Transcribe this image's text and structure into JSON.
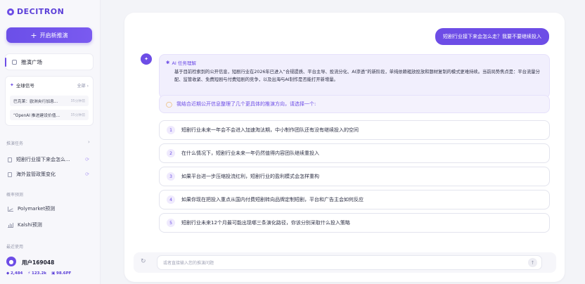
{
  "app": {
    "logo": "DECITRON"
  },
  "sidebar": {
    "new_button": "开启新推演",
    "square": "推演广场",
    "signals": {
      "title": "全球信号",
      "all": "全部",
      "items": [
        {
          "text": "巴克莱：欧洲央行加息...",
          "meta": "35分钟前"
        },
        {
          "text": "“OpenAI 推进建设价值...",
          "meta": "35分钟前"
        }
      ]
    },
    "tasks_label": "推演任务",
    "tasks": [
      {
        "label": "短剧行业接下来会怎么..."
      },
      {
        "label": "海外监管政策变化"
      }
    ],
    "forecast_label": "概率预测",
    "forecasts": [
      {
        "label": "Polymarket预测"
      },
      {
        "label": "Kalshi预测"
      }
    ],
    "recent_label": "最近使用",
    "user": {
      "name": "用户169048",
      "stats": [
        "2,484",
        "123.2k",
        "98.6PF"
      ]
    }
  },
  "chat": {
    "user_message": "短剧行业接下来会怎么走？我要不要继续投入",
    "analysis_title": "AI 任务理解",
    "analysis_body": "基于目前检索到的公开信息，短剧行业在2026年已进入“合规提质、平台主导、投流分化、AI渗透”的新阶段，单纯依赖粗放投放和题材复制的模式更难持续。当前局势焦点是：平台流量分配、监管收紧、免费短剧与付费短剧的竞争，以及出海与AI制作是否能打开新增量。",
    "hint": "我结合近期公开信息整理了几个更具体的推演方向，请选择一个:",
    "options": [
      {
        "num": "1",
        "text": "短剧行业未来一年会不会进入加速淘汰期，中小制作团队还有没有继续投入的空间"
      },
      {
        "num": "2",
        "text": "在什么情况下，短剧行业未来一年仍然值得内容团队继续重投入"
      },
      {
        "num": "3",
        "text": "如果平台进一步压缩投流红利，短剧行业的盈利模式会怎样重构"
      },
      {
        "num": "4",
        "text": "如果你现在把投入重点从国内付费短剧转向品牌定制短剧，平台和广告主会如何反应"
      },
      {
        "num": "5",
        "text": "短剧行业未来12个月最可能出现哪三条演化路径，你该分别采取什么投入策略"
      }
    ],
    "input_placeholder": "或者直接输入您的推演问题"
  },
  "colors": {
    "accent": "#6d4de6",
    "background": "#f3f4f8"
  }
}
